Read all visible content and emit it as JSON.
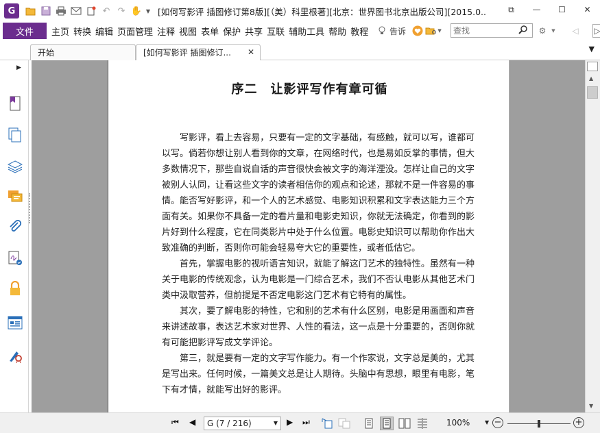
{
  "app": {
    "logo_letter": "G",
    "title": "[如何写影评  插图修订第8版][（美）科里根著][北京：世界图书北京出版公司][2015.0..."
  },
  "window_controls": {
    "restore": "⧉",
    "minimize": "—",
    "maximize": "☐",
    "close": "✕"
  },
  "menu": {
    "file": "文件",
    "items": [
      "主页",
      "转换",
      "编辑",
      "页面管理",
      "注释",
      "视图",
      "表单",
      "保护",
      "共享",
      "互联",
      "辅助工具",
      "帮助",
      "教程"
    ],
    "tell_me": "告诉",
    "search_placeholder": "查找"
  },
  "tabs": [
    {
      "label": "开始"
    },
    {
      "label": "[如何写影评  插图修订..."
    }
  ],
  "document": {
    "title": "序二　让影评写作有章可循",
    "paragraphs": [
      "写影评，看上去容易，只要有一定的文字基础，有感触，就可以写，谁都可以写。倘若你想让别人看到你的文章，在网络时代，也是易如反掌的事情，但大多数情况下，那些自说自话的声音很快会被文字的海洋湮没。怎样让自己的文字被别人认同，让看这些文字的读者相信你的观点和论述，那就不是一件容易的事情。能否写好影评，和一个人的艺术感觉、电影知识积累和文字表达能力三个方面有关。如果你不具备一定的看片量和电影史知识，你就无法确定，你看到的影片好到什么程度，它在同类影片中处于什么位置。电影史知识可以帮助你作出大致准确的判断，否则你可能会轻易夸大它的重要性，或者低估它。",
      "首先，掌握电影的视听语言知识，就能了解这门艺术的独特性。虽然有一种关于电影的传统观念，认为电影是一门综合艺术，我们不否认电影从其他艺术门类中汲取营养，但前提是不否定电影这门艺术有它特有的属性。",
      "其次，要了解电影的特性，它和别的艺术有什么区别，电影是用画面和声音来讲述故事，表达艺术家对世界、人性的看法，这一点是十分重要的，否则你就有可能把影评写成文学评论。",
      "第三，就是要有一定的文字写作能力。有一个作家说，文字总是美的，尤其是写出来。任何时候，一篇美文总是让人期待。头脑中有思想，眼里有电影，笔下有才情，就能写出好的影评。"
    ]
  },
  "status": {
    "page_indicator": "G (7 / 216)",
    "zoom": "100%",
    "zoom_level": 0.5
  },
  "colors": {
    "accent": "#6b2d8e",
    "canvas": "#9e9e9e"
  }
}
